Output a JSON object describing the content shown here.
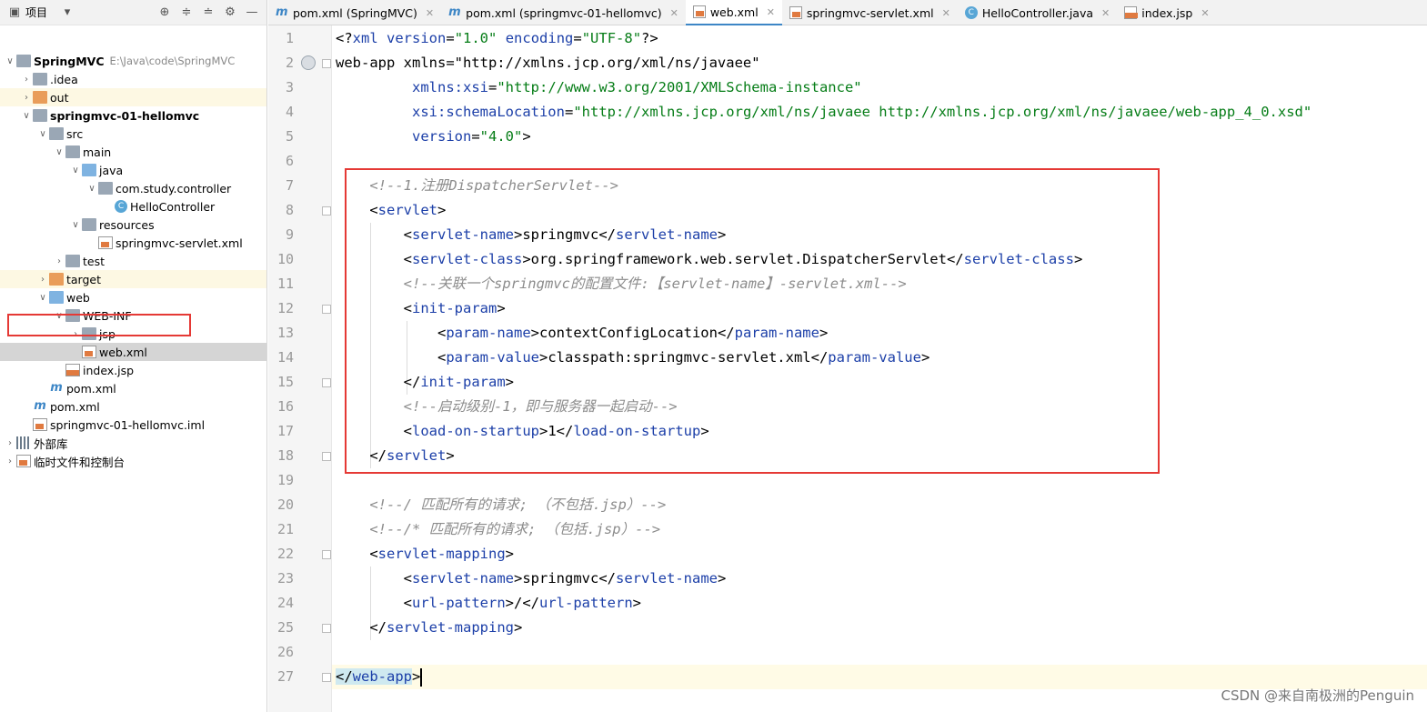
{
  "project_panel": {
    "title": "项目",
    "tree": [
      {
        "label": "SpringMVC",
        "path": "E:\\Java\\code\\SpringMVC",
        "icon": "module-folder-icon",
        "bold": true
      },
      {
        "label": ".idea",
        "icon": "folder-icon"
      },
      {
        "label": "out",
        "icon": "excluded-folder-icon"
      },
      {
        "label": "springmvc-01-hellomvc",
        "icon": "module-folder-icon",
        "bold": true
      },
      {
        "label": "src",
        "icon": "folder-icon"
      },
      {
        "label": "main",
        "icon": "folder-icon"
      },
      {
        "label": "java",
        "icon": "source-folder-icon"
      },
      {
        "label": "com.study.controller",
        "icon": "package-icon"
      },
      {
        "label": "HelloController",
        "icon": "class-icon"
      },
      {
        "label": "resources",
        "icon": "resources-folder-icon"
      },
      {
        "label": "springmvc-servlet.xml",
        "icon": "xml-file-icon"
      },
      {
        "label": "test",
        "icon": "folder-icon"
      },
      {
        "label": "target",
        "icon": "excluded-folder-icon"
      },
      {
        "label": "web",
        "icon": "web-folder-icon"
      },
      {
        "label": "WEB-INF",
        "icon": "folder-icon"
      },
      {
        "label": "jsp",
        "icon": "folder-icon"
      },
      {
        "label": "web.xml",
        "icon": "xml-file-icon"
      },
      {
        "label": "index.jsp",
        "icon": "jsp-file-icon"
      },
      {
        "label": "pom.xml",
        "icon": "maven-icon"
      },
      {
        "label": "pom.xml",
        "icon": "maven-icon"
      },
      {
        "label": "springmvc-01-hellomvc.iml",
        "icon": "iml-file-icon"
      },
      {
        "label": "外部库",
        "icon": "library-icon"
      },
      {
        "label": "临时文件和控制台",
        "icon": "scratch-icon"
      }
    ]
  },
  "tabs": [
    {
      "label": "pom.xml (SpringMVC)",
      "icon": "maven-icon"
    },
    {
      "label": "pom.xml (springmvc-01-hellomvc)",
      "icon": "maven-icon"
    },
    {
      "label": "web.xml",
      "icon": "xml-file-icon",
      "active": true
    },
    {
      "label": "springmvc-servlet.xml",
      "icon": "xml-file-icon"
    },
    {
      "label": "HelloController.java",
      "icon": "class-icon"
    },
    {
      "label": "index.jsp",
      "icon": "jsp-file-icon"
    }
  ],
  "editor": {
    "line_numbers": [
      "1",
      "2",
      "3",
      "4",
      "5",
      "6",
      "7",
      "8",
      "9",
      "10",
      "11",
      "12",
      "13",
      "14",
      "15",
      "16",
      "17",
      "18",
      "19",
      "20",
      "21",
      "22",
      "23",
      "24",
      "25",
      "26",
      "27"
    ],
    "lines": [
      "<?xml version=\"1.0\" encoding=\"UTF-8\"?>",
      "<web-app xmlns=\"http://xmlns.jcp.org/xml/ns/javaee\"",
      "         xmlns:xsi=\"http://www.w3.org/2001/XMLSchema-instance\"",
      "         xsi:schemaLocation=\"http://xmlns.jcp.org/xml/ns/javaee http://xmlns.jcp.org/xml/ns/javaee/web-app_4_0.xsd\"",
      "         version=\"4.0\">",
      "",
      "    <!--1.注册DispatcherServlet-->",
      "    <servlet>",
      "        <servlet-name>springmvc</servlet-name>",
      "        <servlet-class>org.springframework.web.servlet.DispatcherServlet</servlet-class>",
      "        <!--关联一个springmvc的配置文件:【servlet-name】-servlet.xml-->",
      "        <init-param>",
      "            <param-name>contextConfigLocation</param-name>",
      "            <param-value>classpath:springmvc-servlet.xml</param-value>",
      "        </init-param>",
      "        <!--启动级别-1，即与服务器一起启动-->",
      "        <load-on-startup>1</load-on-startup>",
      "    </servlet>",
      "",
      "    <!--/ 匹配所有的请求; （不包括.jsp）-->",
      "    <!--/* 匹配所有的请求; （包括.jsp）-->",
      "    <servlet-mapping>",
      "        <servlet-name>springmvc</servlet-name>",
      "        <url-pattern>/</url-pattern>",
      "    </servlet-mapping>",
      "",
      "</web-app>"
    ]
  },
  "watermark": "CSDN @来自南极洲的Penguin",
  "colors": {
    "tag": "#1c3fa8",
    "value": "#067d17",
    "comment": "#8c8c8c",
    "highlight": "#e53935"
  }
}
